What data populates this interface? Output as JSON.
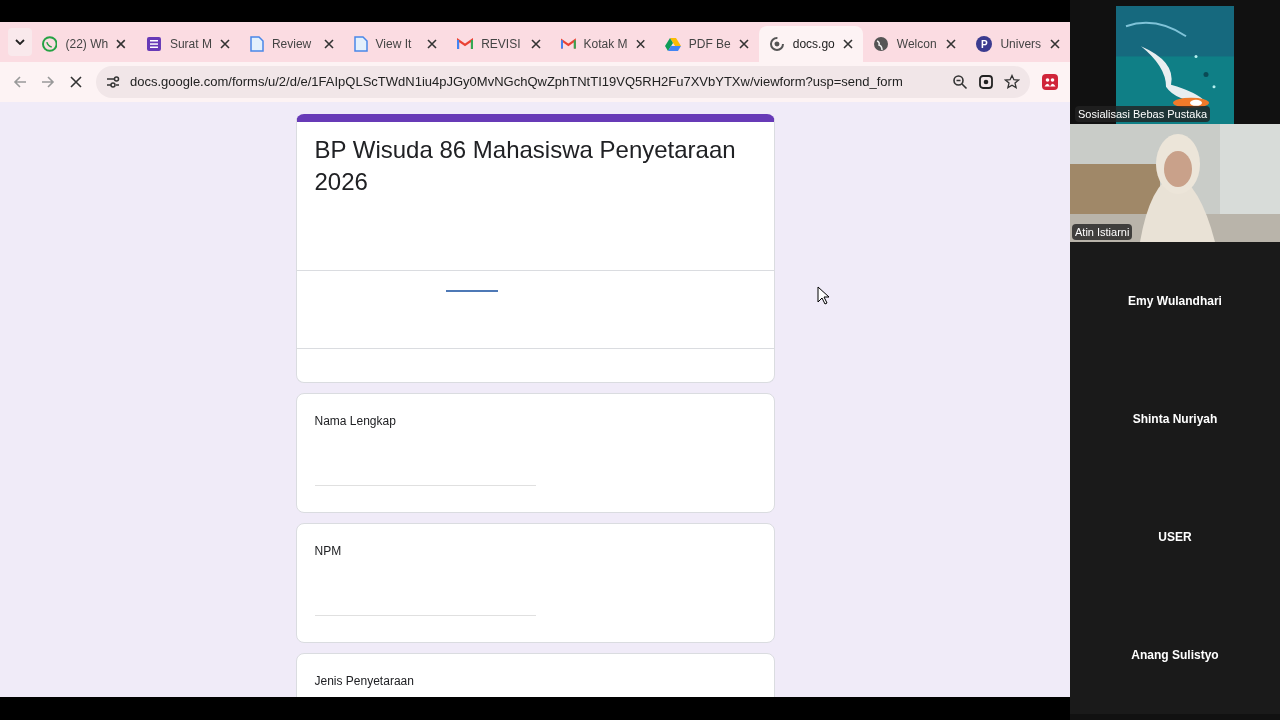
{
  "browser": {
    "tabs": [
      {
        "kind": "whatsapp",
        "title": "(22) Wh",
        "selected": false
      },
      {
        "kind": "forms",
        "title": "Surat M",
        "selected": false
      },
      {
        "kind": "docs",
        "title": "Review",
        "selected": false
      },
      {
        "kind": "docs",
        "title": "View It",
        "selected": false
      },
      {
        "kind": "gmail",
        "title": "REVISI",
        "selected": false
      },
      {
        "kind": "gmail",
        "title": "Kotak M",
        "selected": false
      },
      {
        "kind": "drive",
        "title": "PDF Be",
        "selected": false
      },
      {
        "kind": "loading",
        "title": "docs.go",
        "selected": true
      },
      {
        "kind": "globe",
        "title": "Welcon",
        "selected": false
      },
      {
        "kind": "letter",
        "letter": "P",
        "title": "Univers",
        "selected": false
      }
    ],
    "url": "docs.google.com/forms/u/2/d/e/1FAIpQLScTWdN1iu4pJGy0MvNGchQwZphTNtTI19VQ5RH2Fu7XVbYTXw/viewform?usp=send_form"
  },
  "form": {
    "title": "BP Wisuda 86 Mahasiswa Penyetaraan 2026",
    "questions": [
      {
        "label": "Nama Lengkap",
        "kind": "short_answer"
      },
      {
        "label": "NPM",
        "kind": "short_answer"
      },
      {
        "label": "Jenis Penyetaraan"
      }
    ]
  },
  "meeting": {
    "video_tiles": [
      {
        "name": "Sosialisasi Bebas Pustaka",
        "kind": "artwork"
      },
      {
        "name": "Atin Istiarni",
        "kind": "camera"
      }
    ],
    "participants": [
      {
        "name": "Emy Wulandhari"
      },
      {
        "name": "Shinta Nuriyah"
      },
      {
        "name": "USER"
      },
      {
        "name": "Anang Sulistyo"
      }
    ]
  }
}
